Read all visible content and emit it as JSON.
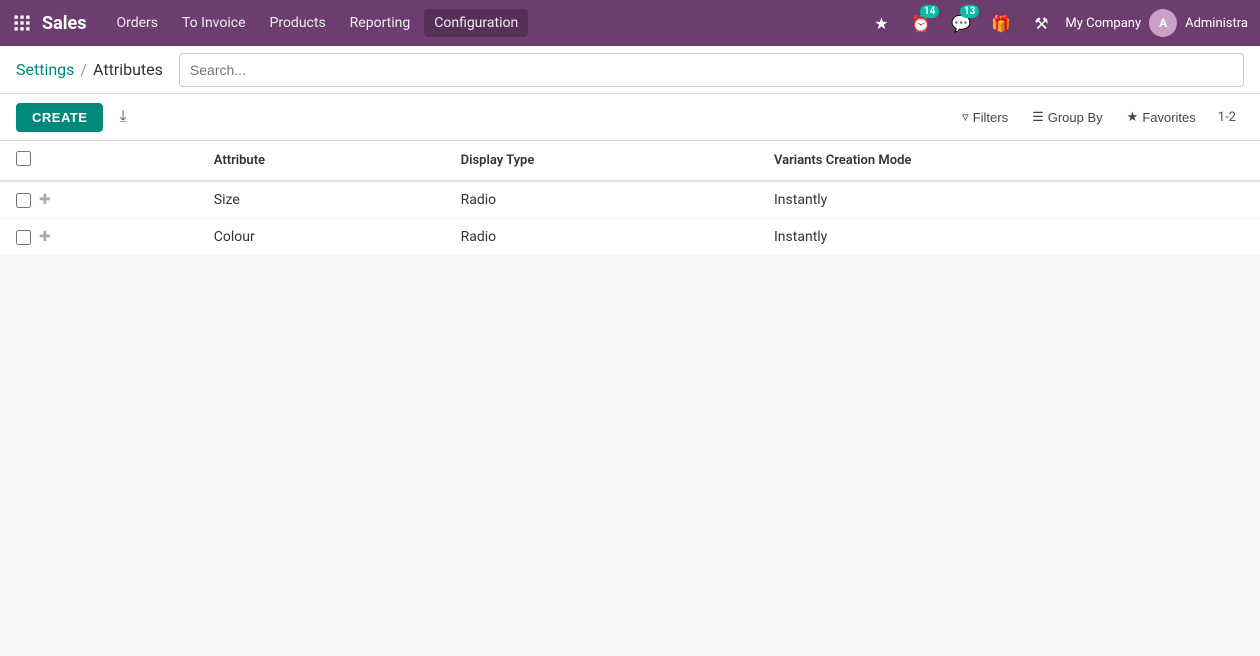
{
  "navbar": {
    "brand": "Sales",
    "menu": [
      {
        "label": "Orders",
        "active": false
      },
      {
        "label": "To Invoice",
        "active": false
      },
      {
        "label": "Products",
        "active": false
      },
      {
        "label": "Reporting",
        "active": false
      },
      {
        "label": "Configuration",
        "active": true
      }
    ],
    "notifications_count": "14",
    "messages_count": "13",
    "company": "My Company",
    "user": "Administra"
  },
  "breadcrumb": {
    "parent": "Settings",
    "separator": "/",
    "current": "Attributes"
  },
  "search": {
    "placeholder": "Search..."
  },
  "toolbar": {
    "create_label": "CREATE",
    "save_icon": "💾",
    "filters_label": "Filters",
    "groupby_label": "Group By",
    "favorites_label": "Favorites",
    "pagination": "1-2"
  },
  "table": {
    "columns": [
      {
        "label": "Attribute"
      },
      {
        "label": "Display Type"
      },
      {
        "label": "Variants Creation Mode"
      }
    ],
    "rows": [
      {
        "id": 1,
        "attribute": "Size",
        "display_type": "Radio",
        "variants_creation_mode": "Instantly"
      },
      {
        "id": 2,
        "attribute": "Colour",
        "display_type": "Radio",
        "variants_creation_mode": "Instantly"
      }
    ]
  }
}
